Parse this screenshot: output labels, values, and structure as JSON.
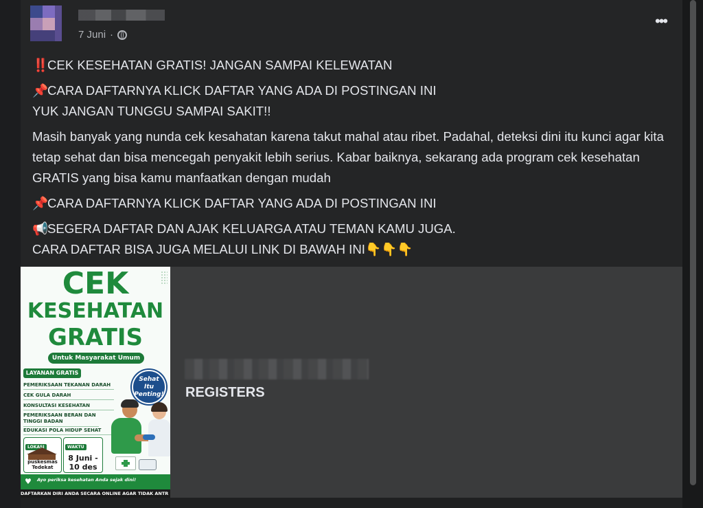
{
  "post": {
    "date": "7 Juni",
    "separator": "·",
    "more_icon": "•••",
    "lines": [
      {
        "emoji": "‼️",
        "text": "CEK KESEHATAN GRATIS! JANGAN SAMPAI KELEWATAN"
      },
      {
        "emoji": "📌",
        "text": "CARA DAFTARNYA KLICK DAFTAR YANG ADA DI POSTINGAN INI"
      },
      {
        "text": "YUK JANGAN TUNGGU SAMPAI SAKIT!!"
      },
      {
        "text": "Masih banyak yang nunda cek kesahatan karena takut mahal atau ribet. Padahal, deteksi dini itu kunci agar kita tetap sehat dan bisa mencegah penyakit lebih serius. Kabar baiknya, sekarang ada program cek kesehatan GRATIS yang bisa kamu manfaatkan dengan mudah"
      },
      {
        "emoji": "📌",
        "text": "CARA DAFTARNYA KLICK DAFTAR YANG ADA DI POSTINGAN INI"
      },
      {
        "emoji": "📢",
        "text": "SEGERA DAFTAR DAN AJAK KELUARGA ATAU TEMAN KAMU JUGA."
      },
      {
        "text": "CARA DAFTAR BISA JUGA MELALUI LINK DI BAWAH INI",
        "emoji_after": "👇👇👇"
      }
    ]
  },
  "link_card": {
    "title": "REGISTERS",
    "poster": {
      "line1": "CEK",
      "line2": "KESEHATAN",
      "line3": "GRATIS",
      "subtitle": "Untuk Masyarakat Umum",
      "services_title": "LAYANAN GRATIS",
      "services": [
        "PEMERIKSAAN TEKANAN DARAH",
        "CEK GULA DARAH",
        "KONSULTASI KESEHATAN",
        "PEMERIKSAAN BERAN DAN TINGGI BADAN",
        "EDUKASI POLA HIDUP SEHAT"
      ],
      "badge": "Sehat Itu Penting!",
      "location_label": "LOKASI",
      "location": "puskesmas Tedekat",
      "time_label": "WAKTU",
      "date_range_1": "8 Juni -",
      "date_range_2": "10 des",
      "tagline": "Ayo periksa kesehatan Anda sejak dini!",
      "footer": "DAFTARKAN DIRI ANDA SECARA ONLINE AGAR TIDAK ANTR"
    }
  },
  "colors": {
    "page_bg": "#18191a",
    "post_bg": "#242526",
    "card_bg": "#3a3b3c",
    "text": "#e4e6eb",
    "muted": "#b0b3b8",
    "poster_green": "#1f8a3c"
  }
}
